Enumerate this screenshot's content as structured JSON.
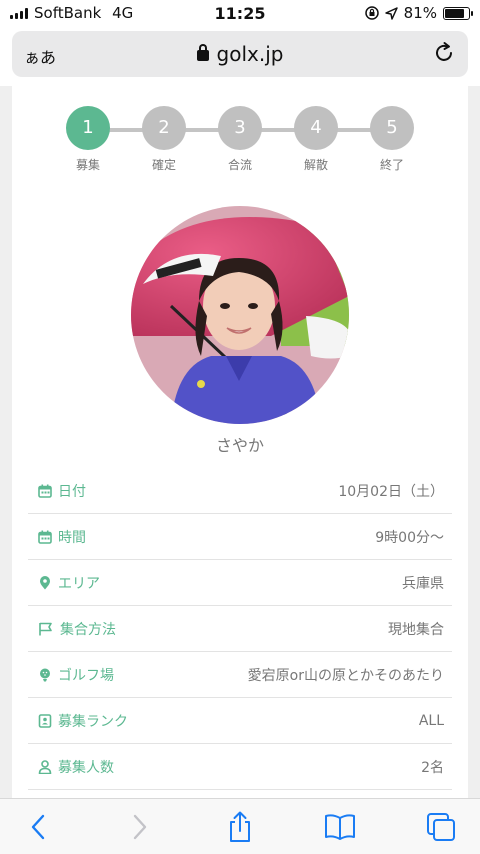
{
  "status_bar": {
    "carrier": "SoftBank",
    "network": "4G",
    "time": "11:25",
    "battery_percent": "81%",
    "battery_level": 0.81
  },
  "browser": {
    "text_size_label": "ぁあ",
    "domain": "golx.jp"
  },
  "stepper": {
    "active_index": 0,
    "steps": [
      {
        "number": "1",
        "label": "募集"
      },
      {
        "number": "2",
        "label": "確定"
      },
      {
        "number": "3",
        "label": "合流"
      },
      {
        "number": "4",
        "label": "解散"
      },
      {
        "number": "5",
        "label": "終了"
      }
    ]
  },
  "profile": {
    "nickname": "さやか"
  },
  "details": [
    {
      "icon": "calendar-icon",
      "label": "日付",
      "value": "10月02日（土）"
    },
    {
      "icon": "calendar-icon",
      "label": "時間",
      "value": "9時00分〜"
    },
    {
      "icon": "location-pin-icon",
      "label": "エリア",
      "value": "兵庫県"
    },
    {
      "icon": "flag-icon",
      "label": "集合方法",
      "value": "現地集合"
    },
    {
      "icon": "golf-ball-icon",
      "label": "ゴルフ場",
      "value": "愛宕原or山の原とかそのあたり"
    },
    {
      "icon": "id-card-icon",
      "label": "募集ランク",
      "value": "ALL"
    },
    {
      "icon": "person-icon",
      "label": "募集人数",
      "value": "2名"
    }
  ],
  "colors": {
    "accent": "#5cb891",
    "step_inactive": "#c0c0c0",
    "ios_blue": "#1a7cf4"
  }
}
